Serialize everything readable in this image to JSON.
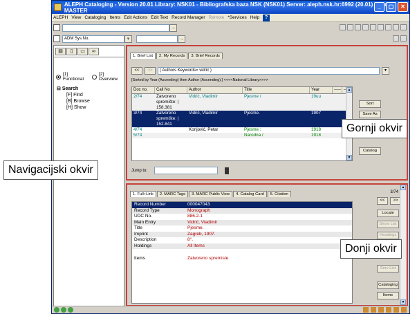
{
  "window": {
    "title": "ALEPH Cataloging - Version 20.01  Library:  NSK01 - Bibliografska baza NSK (NSK01)  Server:  aleph.nsk.hr:6992 (20.01)  User:  MASTER"
  },
  "menu": {
    "items": [
      "ALEPH",
      "View",
      "Cataloging",
      "Items",
      "Edit Actions",
      "Edit Text",
      "Record Manager"
    ],
    "disabled": "Remote",
    "services": "*Services",
    "help": "Help",
    "help_icon": "?"
  },
  "toolbar": {
    "index_value": "ADM Sys No.",
    "go": "→"
  },
  "left_panel": {
    "radio_functional": "[1] Functional",
    "radio_overview": "[2] Overview",
    "tree_root": "Search",
    "tree_nodes": [
      "[F] Find",
      "[B] Browse",
      "[H] Show"
    ]
  },
  "upper": {
    "tabs": [
      "1. Brief List",
      "2. My Records",
      "3. Brief Records"
    ],
    "nav_prev": "<<",
    "nav_next": ">>",
    "query": "( Authors Keywords= vidrić )",
    "sort_info": "[Sorted by Year (Ascending) then Author (Ascending).]   <<<<National Library>>>>",
    "columns": [
      "Doc no.",
      "Call No",
      "Author",
      "Title",
      "Year",
      "-----",
      "-----"
    ],
    "rows": [
      {
        "doc": "2/74",
        "call": "Zatvoreno",
        "author": "Vidrić, Vladimir",
        "title": "Pjesme /",
        "year": "19uu"
      },
      {
        "doc": "",
        "call": "spremište:  |",
        "author": "",
        "title": "",
        "year": ""
      },
      {
        "doc": "",
        "call": "158.381",
        "author": "",
        "title": "",
        "year": ""
      },
      {
        "doc": "3/74",
        "call": "Zatvoreno",
        "author": "Vidrić, Vladimir",
        "title": "Pjesme.",
        "year": "1907"
      },
      {
        "doc": "",
        "call": "spremište:  |",
        "author": "",
        "title": "",
        "year": ""
      },
      {
        "doc": "",
        "call": "152.841",
        "author": "",
        "title": "",
        "year": ""
      },
      {
        "doc": "4/74",
        "call": "",
        "author": "Konjović, Petar",
        "title": "Pjesme :",
        "year": "1918"
      },
      {
        "doc": "5/74",
        "call": "",
        "author": "",
        "title": "Narodna /",
        "year": "1918"
      }
    ],
    "sort_btn": "Sort",
    "save_btn": "Save As",
    "catalog_btn": "Catalog",
    "jump_label": "Jump to:"
  },
  "lower": {
    "tabs": [
      "1. Full+Link",
      "2. MARC Tags",
      "3. MARC Public View",
      "4. Catalog Card",
      "5. Citation"
    ],
    "counter": "3/74",
    "nav_prev": "<<",
    "nav_next": ">>",
    "fields": [
      {
        "k": "Record Number",
        "v": "000047043"
      },
      {
        "k": "Record Type",
        "v": "Monograph"
      },
      {
        "k": "UDC No.",
        "v": "886.2-1"
      },
      {
        "k": "Main Entry",
        "v": "Vidrić, Vladimir"
      },
      {
        "k": "Title",
        "v": "Pjesme."
      },
      {
        "k": "Imprint",
        "v": "Zagreb, 1907."
      },
      {
        "k": "Description",
        "v": "8°."
      },
      {
        "k": "Holdings",
        "v": "All Items"
      },
      {
        "k": "",
        "v": ""
      },
      {
        "k": "Items",
        "v": "Zatvoreno spremiste"
      }
    ],
    "locate_btn": "Locate",
    "showlist_btn": "Show List",
    "headings_btn": "Headings",
    "servlist_btn": "Serv List",
    "cataloging_btn": "Cataloging",
    "items_btn": "Items"
  },
  "callouts": {
    "nav": "Navigacijski okvir",
    "upper": "Gornji okvir",
    "lower": "Donji okvir"
  }
}
